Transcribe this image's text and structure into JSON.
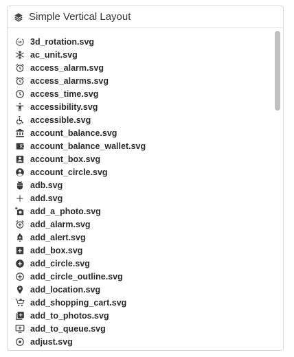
{
  "panel": {
    "title": "Simple Vertical Layout",
    "icon": "layers-icon"
  },
  "items": [
    {
      "label": "3d_rotation.svg",
      "icon": "3d-rotation-icon"
    },
    {
      "label": "ac_unit.svg",
      "icon": "snowflake-icon"
    },
    {
      "label": "access_alarm.svg",
      "icon": "alarm-icon"
    },
    {
      "label": "access_alarms.svg",
      "icon": "alarms-icon"
    },
    {
      "label": "access_time.svg",
      "icon": "clock-icon"
    },
    {
      "label": "accessibility.svg",
      "icon": "accessibility-icon"
    },
    {
      "label": "accessible.svg",
      "icon": "wheelchair-icon"
    },
    {
      "label": "account_balance.svg",
      "icon": "bank-icon"
    },
    {
      "label": "account_balance_wallet.svg",
      "icon": "wallet-icon"
    },
    {
      "label": "account_box.svg",
      "icon": "account-box-icon"
    },
    {
      "label": "account_circle.svg",
      "icon": "account-circle-icon"
    },
    {
      "label": "adb.svg",
      "icon": "android-icon"
    },
    {
      "label": "add.svg",
      "icon": "plus-icon"
    },
    {
      "label": "add_a_photo.svg",
      "icon": "add-photo-icon"
    },
    {
      "label": "add_alarm.svg",
      "icon": "add-alarm-icon"
    },
    {
      "label": "add_alert.svg",
      "icon": "add-alert-icon"
    },
    {
      "label": "add_box.svg",
      "icon": "add-box-icon"
    },
    {
      "label": "add_circle.svg",
      "icon": "add-circle-icon"
    },
    {
      "label": "add_circle_outline.svg",
      "icon": "add-circle-outline-icon"
    },
    {
      "label": "add_location.svg",
      "icon": "add-location-icon"
    },
    {
      "label": "add_shopping_cart.svg",
      "icon": "add-cart-icon"
    },
    {
      "label": "add_to_photos.svg",
      "icon": "add-to-photos-icon"
    },
    {
      "label": "add_to_queue.svg",
      "icon": "add-to-queue-icon"
    },
    {
      "label": "adjust.svg",
      "icon": "adjust-icon"
    }
  ]
}
